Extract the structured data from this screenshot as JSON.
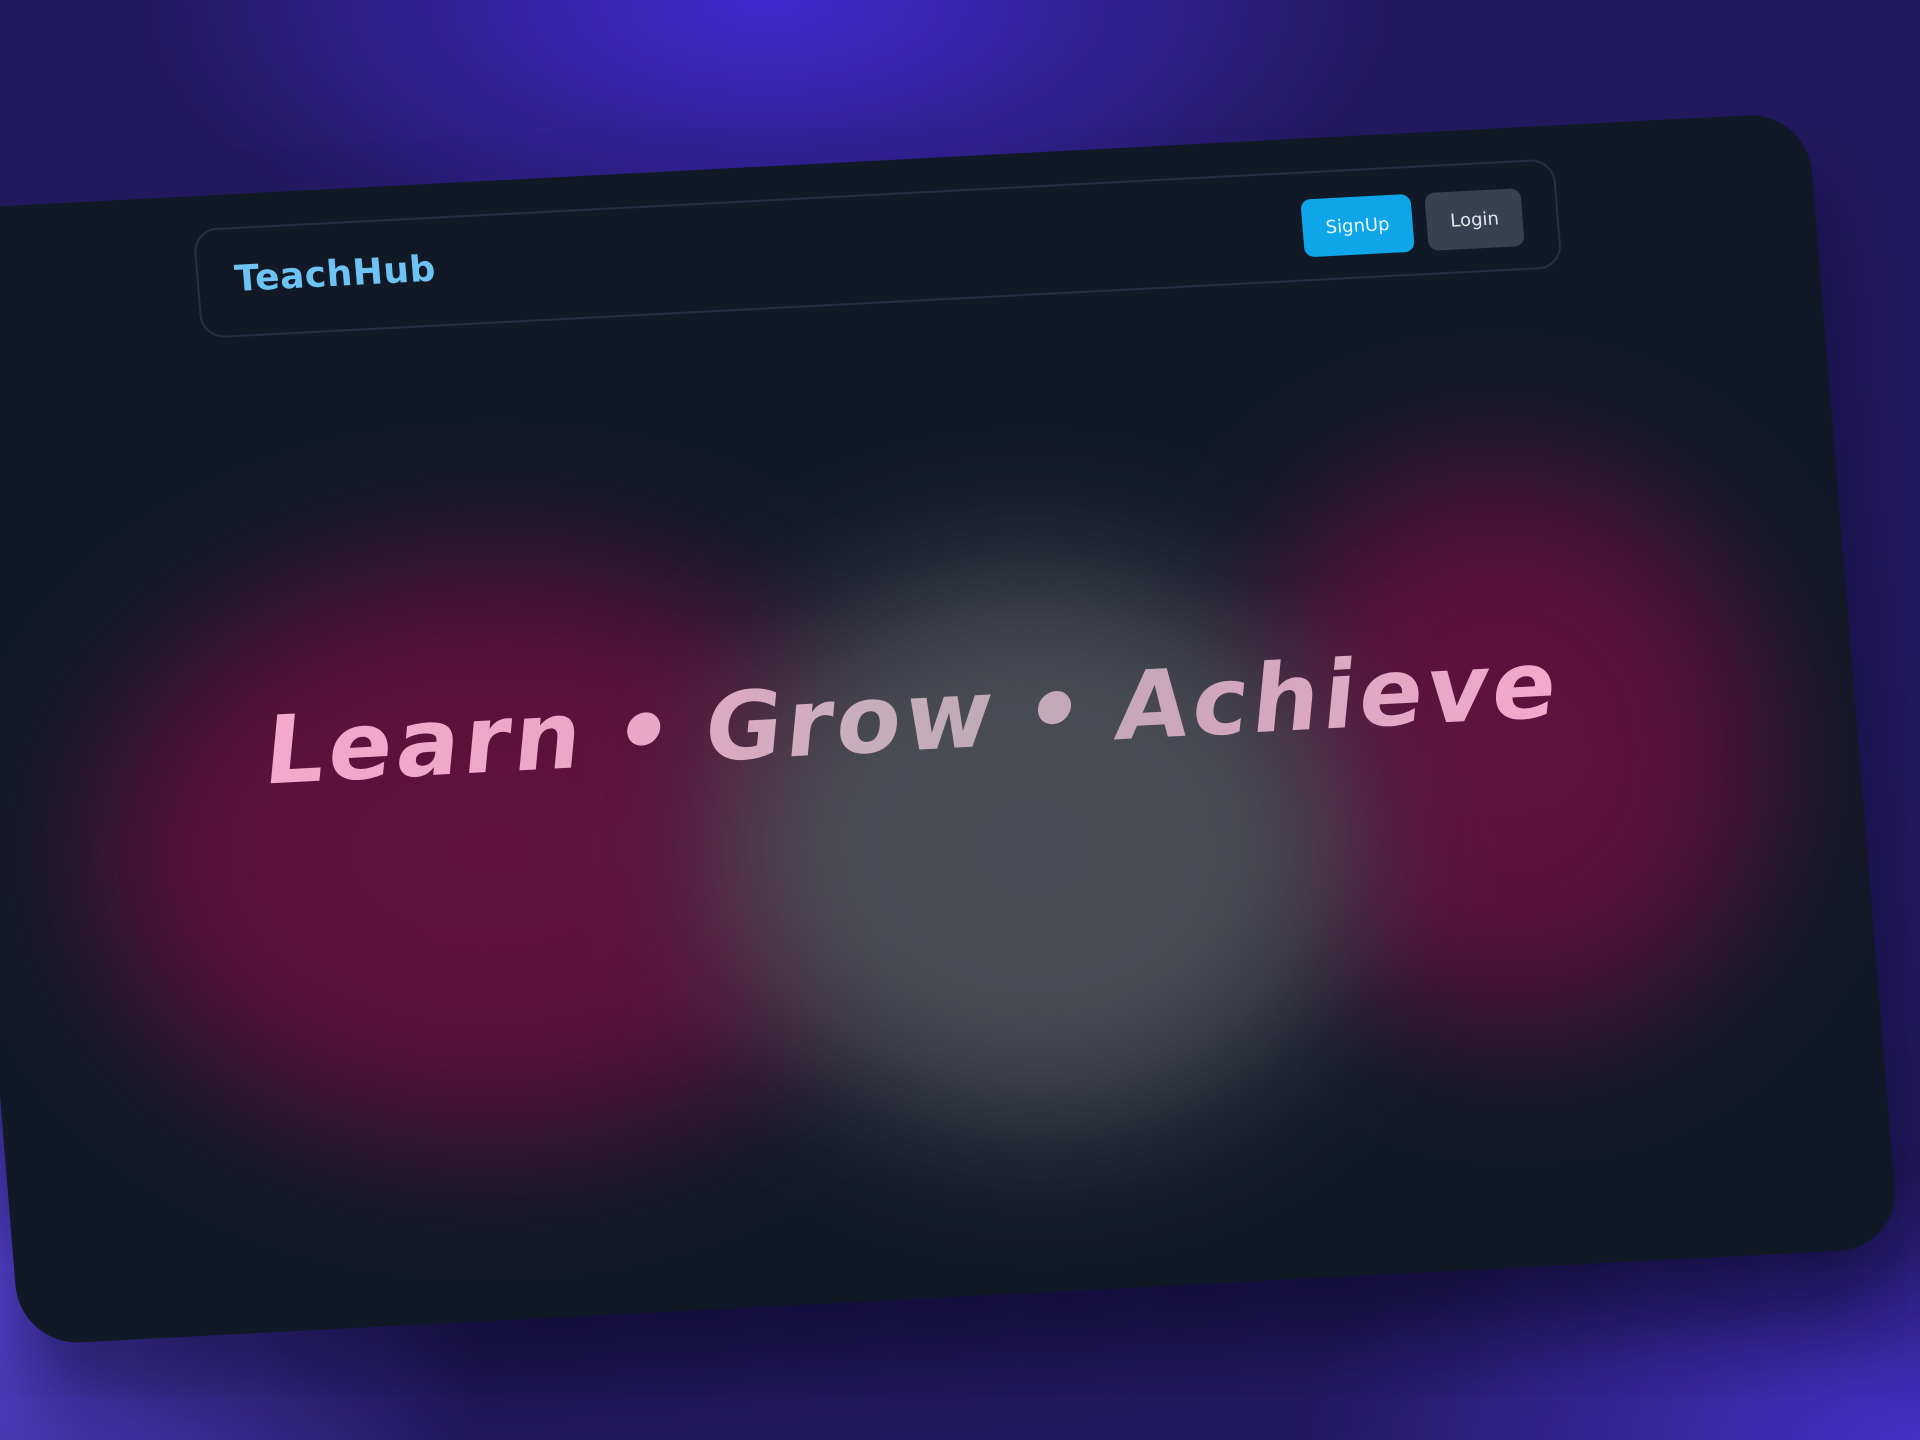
{
  "app": {
    "brand": "TeachHub"
  },
  "navbar": {
    "signup_label": "SignUp",
    "login_label": "Login"
  },
  "hero": {
    "words": [
      "Learn",
      "Grow",
      "Achieve"
    ],
    "separator": "•"
  },
  "colors": {
    "background": "#23195f",
    "window": "#121926",
    "brand": "#6ec3f5",
    "signup_button": "#0ea5e9",
    "login_button": "#374151",
    "glow_magenta": "#5a1139",
    "glow_gray": "#4a4c54",
    "tagline_pink": "#f2a9cb"
  }
}
